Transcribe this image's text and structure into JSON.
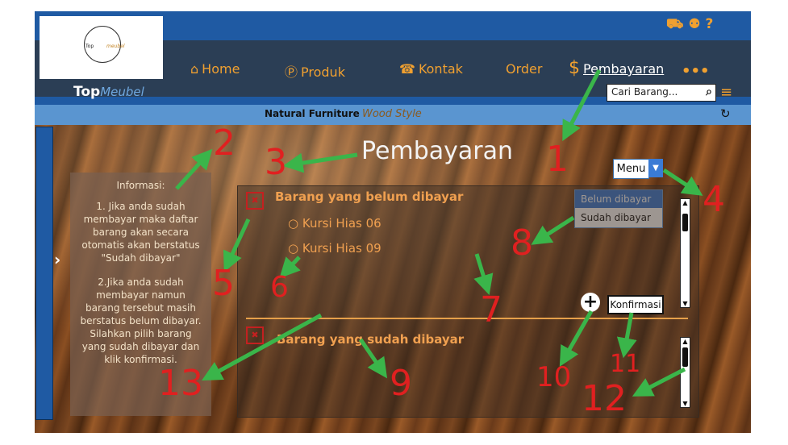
{
  "logo": {
    "small_text_a": "Top",
    "small_text_b": "meubel"
  },
  "brand": {
    "name_a": "Top",
    "name_b": "Meubel"
  },
  "nav": [
    {
      "label": "Home",
      "icon": "home-icon"
    },
    {
      "label": "Produk",
      "icon": "p-circle-icon"
    },
    {
      "label": "Kontak",
      "icon": "phone-icon"
    },
    {
      "label": "Order",
      "icon": ""
    },
    {
      "label": "Pembayaran",
      "icon": "dollar-icon"
    }
  ],
  "more_label": "•••",
  "search": {
    "placeholder": "Cari Barang..."
  },
  "subbar": {
    "text_a": "Natural Furniture",
    "text_b": "Wood Style"
  },
  "info": {
    "title": "Informasi:",
    "p1": "1. Jika anda sudah membayar maka daftar barang akan secara otomatis akan berstatus \"Sudah dibayar\"",
    "p2": "2.Jika anda sudah membayar namun barang tersebut masih berstatus belum dibayar. Silahkan pilih barang yang sudah dibayar dan klik konfirmasi."
  },
  "page_title": "Pembayaran",
  "menu": {
    "label": "Menu",
    "options": [
      "Belum dibayar",
      "Sudah dibayar"
    ]
  },
  "section_unpaid": {
    "title": "Barang yang belum dibayar",
    "items": [
      "Kursi Hias 06",
      "Kursi Hias 09"
    ]
  },
  "section_paid": {
    "title": "Barang yang sudah dibayar"
  },
  "confirm_label": "Konfirmasi",
  "annotations": [
    "1",
    "2",
    "3",
    "4",
    "5",
    "6",
    "7",
    "8",
    "9",
    "10",
    "11",
    "12",
    "13"
  ],
  "colors": {
    "accent": "#f0a030",
    "brand_blue": "#1f5aa3",
    "annotation_red": "#e02020",
    "annotation_green": "#3ab54a"
  }
}
